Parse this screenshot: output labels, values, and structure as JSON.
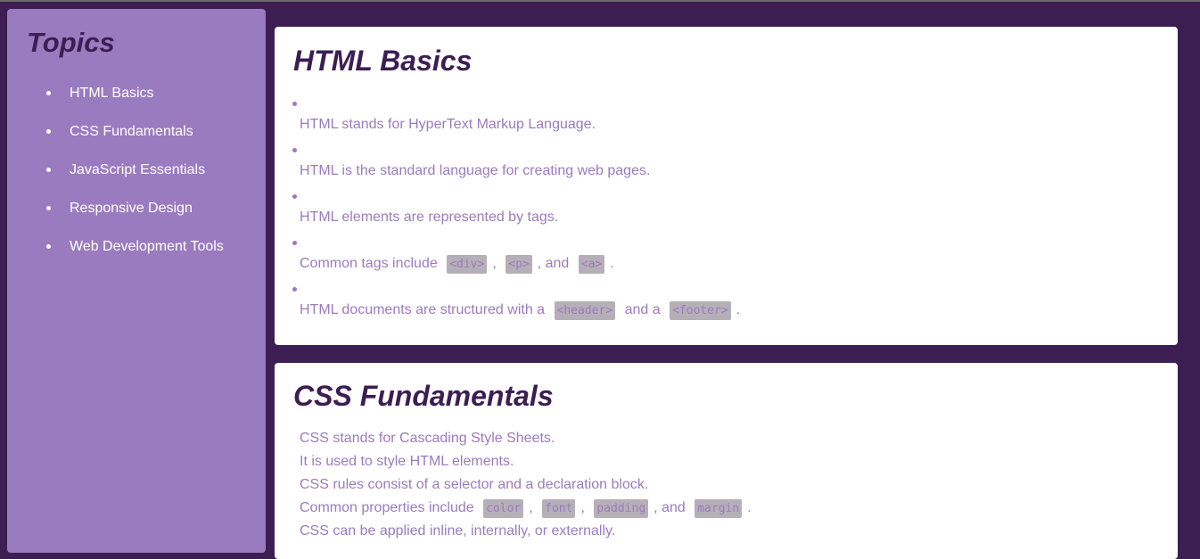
{
  "sidebar": {
    "title": "Topics",
    "items": [
      {
        "label": "HTML Basics"
      },
      {
        "label": "CSS Fundamentals"
      },
      {
        "label": "JavaScript Essentials"
      },
      {
        "label": "Responsive Design"
      },
      {
        "label": "Web Development Tools"
      }
    ]
  },
  "html_section": {
    "title": "HTML Basics",
    "p1": "HTML stands for HyperText Markup Language.",
    "p2": "HTML is the standard language for creating web pages.",
    "p3": "HTML elements are represented by tags.",
    "p4": {
      "prefix": "Common tags include",
      "code1": "<div>",
      "sep1": ",",
      "code2": "<p>",
      "sep2": ", and",
      "code3": "<a>",
      "suffix": "."
    },
    "p5": {
      "prefix": "HTML documents are structured with a",
      "code1": "<header>",
      "mid": "and a",
      "code2": "<footer>",
      "suffix": "."
    }
  },
  "css_section": {
    "title": "CSS Fundamentals",
    "l1": "CSS stands for Cascading Style Sheets.",
    "l2": "It is used to style HTML elements.",
    "l3": "CSS rules consist of a selector and a declaration block.",
    "l4": {
      "prefix": "Common properties include",
      "code1": "color",
      "sep1": ",",
      "code2": "font",
      "sep2": ",",
      "code3": "padding",
      "sep3": ", and",
      "code4": "margin",
      "suffix": "."
    },
    "l5": "CSS can be applied inline, internally, or externally."
  }
}
